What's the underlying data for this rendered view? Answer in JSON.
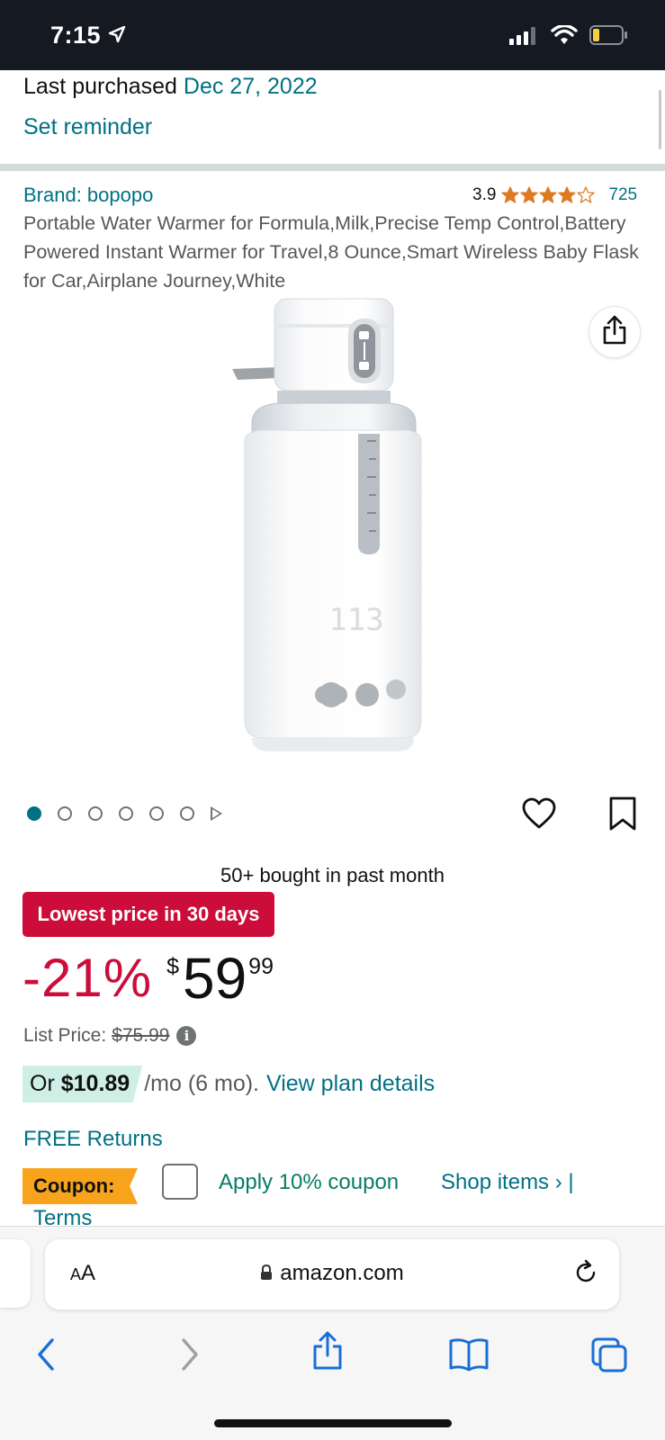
{
  "status": {
    "time": "7:15"
  },
  "purchase": {
    "label": "Last purchased",
    "date": "Dec 27, 2022",
    "reminder": "Set reminder"
  },
  "product": {
    "brand": "Brand: bopopo",
    "rating": "3.9",
    "rating_stars": 3.9,
    "rating_count": "725",
    "title": "Portable Water Warmer for Formula,Milk,Precise Temp Control,Battery Powered Instant Warmer for Travel,8 Ounce,Smart Wireless Baby Flask for Car,Airplane Journey,White",
    "display_reading": "113",
    "image_count": 6,
    "active_image": 1
  },
  "offer": {
    "bought": "50+ bought in past month",
    "badge": "Lowest price in 30 days",
    "discount": "-21%",
    "currency": "$",
    "price_whole": "59",
    "price_fraction": "99",
    "list_price_label": "List Price:",
    "list_price": "$75.99",
    "info_icon": "i",
    "plan_or": "Or",
    "plan_amount": "$10.89",
    "plan_term": "/mo (6 mo).",
    "plan_link": "View plan details",
    "returns": "FREE Returns",
    "coupon_label": "Coupon:",
    "coupon_apply": "Apply 10% coupon",
    "coupon_shop": "Shop items › |",
    "coupon_terms": "Terms"
  },
  "browser": {
    "aa_label_big": "A",
    "aa_label_small": "A",
    "url": "amazon.com"
  },
  "colors": {
    "link": "#007185",
    "deal_red": "#cc0c39",
    "coupon_orange": "#f7a31c",
    "star": "#de7921",
    "status_bg": "#141922"
  },
  "icons": [
    "location-arrow-icon",
    "signal-icon",
    "wifi-icon",
    "battery-icon",
    "share-icon",
    "heart-icon",
    "bookmark-icon",
    "info-icon",
    "lock-icon",
    "reload-icon",
    "back-icon",
    "forward-icon",
    "safari-share-icon",
    "bookmarks-icon",
    "tabs-icon"
  ]
}
